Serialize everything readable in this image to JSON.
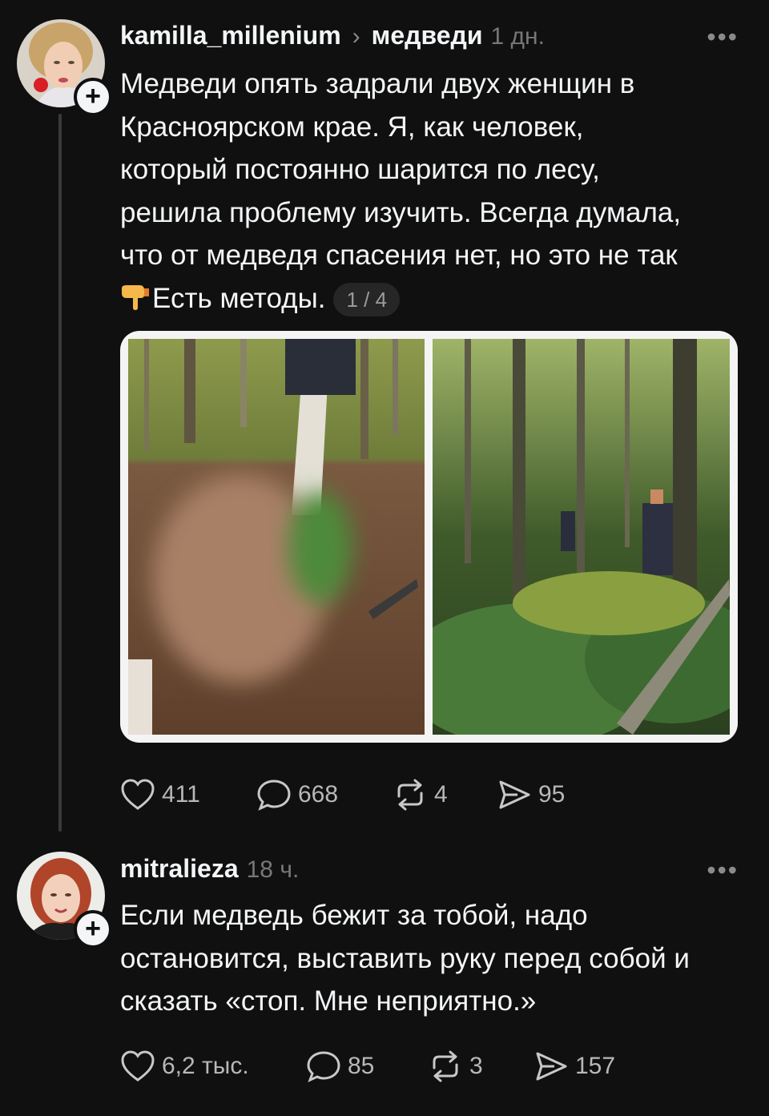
{
  "posts": [
    {
      "username": "kamilla_millenium",
      "topic": "медведи",
      "time": "1 дн.",
      "more": "•••",
      "text_lines": [
        "Медведи опять задрали двух женщин в",
        "Красноярском крае. Я, как человек,",
        "который постоянно шарится по лесу,",
        "решила проблему изучить. Всегда думала,",
        "что от медведя спасения нет, но это не так"
      ],
      "last_line": "Есть методы.",
      "point_icon": "backhand-index-pointing-down-icon",
      "page_indicator": "1 / 4",
      "stats": {
        "likes": "411",
        "replies": "668",
        "reposts": "4",
        "shares": "95"
      }
    },
    {
      "username": "mitralieza",
      "time": "18 ч.",
      "more": "•••",
      "text_lines": [
        "Если медведь бежит за тобой, надо",
        "остановится, выставить руку перед собой и",
        "сказать «стоп. Мне неприятно.»"
      ],
      "stats": {
        "likes": "6,2 тыс.",
        "replies": "85",
        "reposts": "3",
        "shares": "157"
      }
    }
  ],
  "icons": {
    "like": "heart-icon",
    "reply": "speech-bubble-icon",
    "repost": "repost-icon",
    "share": "send-icon",
    "follow": "plus-icon"
  },
  "colors": {
    "background": "#101010",
    "text": "#f3f5f7",
    "muted": "#777777",
    "thread_line": "#3a3a3a"
  }
}
